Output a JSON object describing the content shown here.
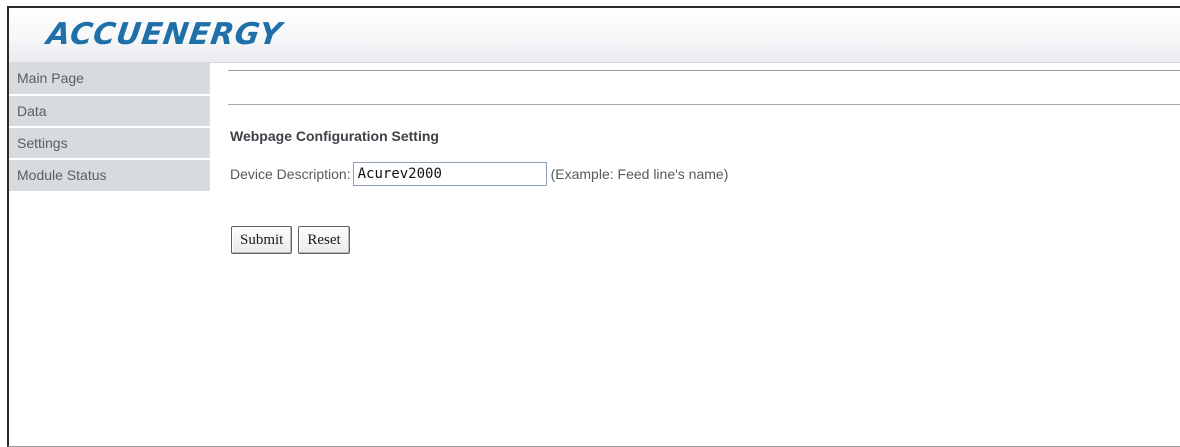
{
  "header": {
    "logo_text": "ACCUENERGY",
    "brand_color": "#1f6fa8"
  },
  "sidebar": {
    "items": [
      {
        "label": "Main Page"
      },
      {
        "label": "Data"
      },
      {
        "label": "Settings"
      },
      {
        "label": "Module Status"
      }
    ]
  },
  "main": {
    "section_title": "Webpage Configuration Setting",
    "device_description": {
      "label": "Device Description:",
      "value": "Acurev2000",
      "hint": "(Example: Feed line's name)"
    },
    "buttons": {
      "submit_label": "Submit",
      "reset_label": "Reset"
    }
  }
}
